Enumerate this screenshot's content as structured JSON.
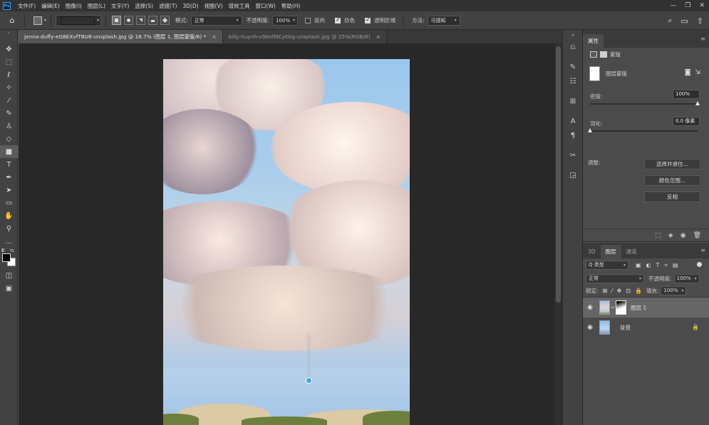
{
  "app": {
    "logo": "Ps",
    "menu": [
      "文件(F)",
      "编辑(E)",
      "图像(I)",
      "图层(L)",
      "文字(Y)",
      "选择(S)",
      "滤镜(T)",
      "3D(D)",
      "视图(V)",
      "增效工具",
      "窗口(W)",
      "帮助(H)"
    ],
    "window_controls": {
      "minimize": "—",
      "restore": "❐",
      "close": "✕"
    }
  },
  "options_bar": {
    "home_icon": "home-icon",
    "mode_label": "模式:",
    "mode_value": "正常",
    "opacity_label": "不透明度:",
    "opacity_value": "100%",
    "reverse_label": "反向",
    "reverse_checked": false,
    "dither_label": "仿色",
    "dither_checked": true,
    "transparency_label": "透明区域",
    "transparency_checked": true,
    "method_label": "方法:",
    "method_value": "可感知"
  },
  "tabs": [
    {
      "label": "jenna-duffy-eG8EXvfTBU8-unsplash.jpg @ 16.7% (图层 1, 图层蒙版/8) *",
      "active": true,
      "close": "×"
    },
    {
      "label": "billy-huynh-v9bnfMCyKbg-unsplash.jpg @ 25%(RGB/8)",
      "active": false,
      "close": "×"
    }
  ],
  "toolbar": {
    "grip": "»",
    "tools": [
      "move-icon",
      "marquee-icon",
      "lasso-icon",
      "magic-wand-icon",
      "eyedropper-icon",
      "brush-icon",
      "stamp-icon",
      "eraser-icon",
      "gradient-icon",
      "type-icon",
      "pen-icon",
      "path-select-icon",
      "rectangle-icon",
      "hand-icon",
      "zoom-icon",
      "more-icon"
    ],
    "active_tool": "gradient-icon",
    "foreground_color": "#000000",
    "background_color": "#ffffff"
  },
  "properties": {
    "tabs": [
      "属性"
    ],
    "section_label": "蒙版",
    "layer_mask_label": "图层蒙版",
    "density_label": "密度:",
    "density_value": "100%",
    "density": 1.0,
    "feather_label": "羽化:",
    "feather_value": "0.0 像素",
    "feather": 0.0,
    "adjust_label": "调整:",
    "buttons": [
      "选择并遮住...",
      "颜色范围...",
      "反相"
    ]
  },
  "layers": {
    "tabs": [
      "3D",
      "图层",
      "通道"
    ],
    "active_tab": "图层",
    "filter_value": "Q 类型",
    "blend_mode": "正常",
    "opacity_label": "不透明度:",
    "opacity_value": "100%",
    "lock_label": "锁定:",
    "fill_label": "填充:",
    "fill_value": "100%",
    "items": [
      {
        "name": "图层 1",
        "selected": true,
        "has_mask": true,
        "locked": false
      },
      {
        "name": "背景",
        "selected": false,
        "has_mask": false,
        "locked": true
      }
    ]
  },
  "colors": {
    "accent": "#31a8ff",
    "panel": "#535353",
    "canvas_bg": "#282828",
    "gradient_handle": "#3ba7e8"
  }
}
